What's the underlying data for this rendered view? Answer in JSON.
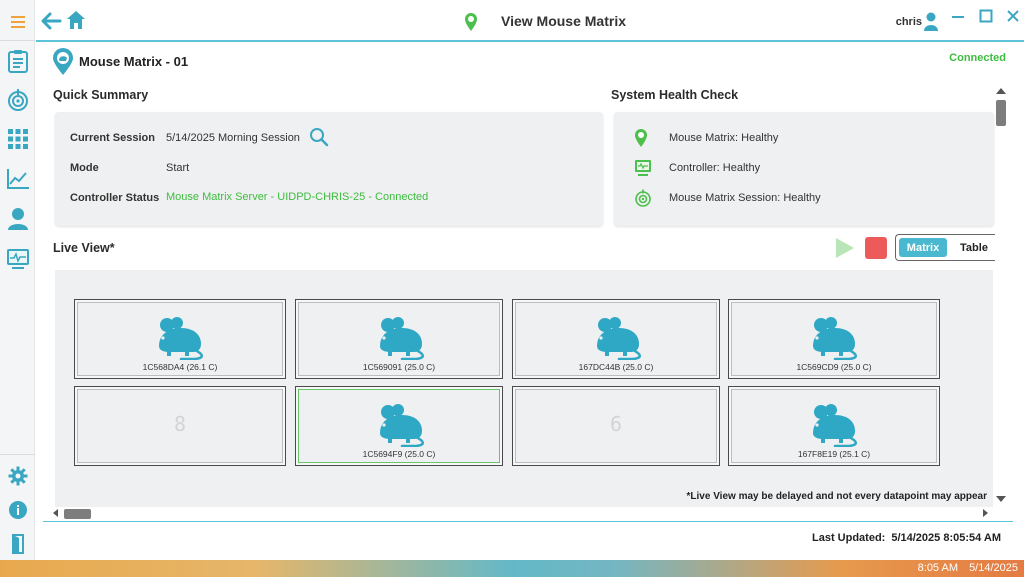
{
  "window": {
    "title": "View Mouse Matrix",
    "user": "chris"
  },
  "device": {
    "title": "Mouse Matrix - 01",
    "status": "Connected"
  },
  "summary": {
    "title": "Quick Summary",
    "session_label": "Current Session",
    "session_value": "5/14/2025 Morning Session",
    "mode_label": "Mode",
    "mode_value": "Start",
    "controller_label": "Controller Status",
    "controller_value": "Mouse Matrix Server - UIDPD-CHRIS-25 - Connected"
  },
  "health": {
    "title": "System Health Check",
    "items": [
      {
        "text": "Mouse Matrix: Healthy",
        "icon": "location-pin-icon"
      },
      {
        "text": "Controller: Healthy",
        "icon": "monitor-icon"
      },
      {
        "text": "Mouse Matrix Session: Healthy",
        "icon": "radar-icon"
      }
    ]
  },
  "live": {
    "title": "Live View*",
    "view_matrix": "Matrix",
    "view_table": "Table",
    "cages": [
      {
        "label": "1C568DA4 (26.1 C)"
      },
      {
        "label": "1C569091 (25.0 C)"
      },
      {
        "label": "167DC44B (25.0 C)"
      },
      {
        "label": "1C569CD9 (25.0 C)"
      },
      {
        "number": "8"
      },
      {
        "label": "1C5694F9 (25.0 C)"
      },
      {
        "number": "6"
      },
      {
        "label": "167F8E19 (25.1 C)"
      }
    ],
    "disclaimer": "*Live View may be delayed and not every datapoint may appear"
  },
  "footer": {
    "last_updated_label": "Last Updated:",
    "last_updated_value": "5/14/2025 8:05:54 AM"
  },
  "taskbar": {
    "time": "8:05 AM",
    "date": "5/14/2025"
  },
  "colors": {
    "accent": "#4ab8cf",
    "healthy": "#3ebd3e",
    "stop": "#ec5a5a",
    "menu": "#f0a23c"
  }
}
